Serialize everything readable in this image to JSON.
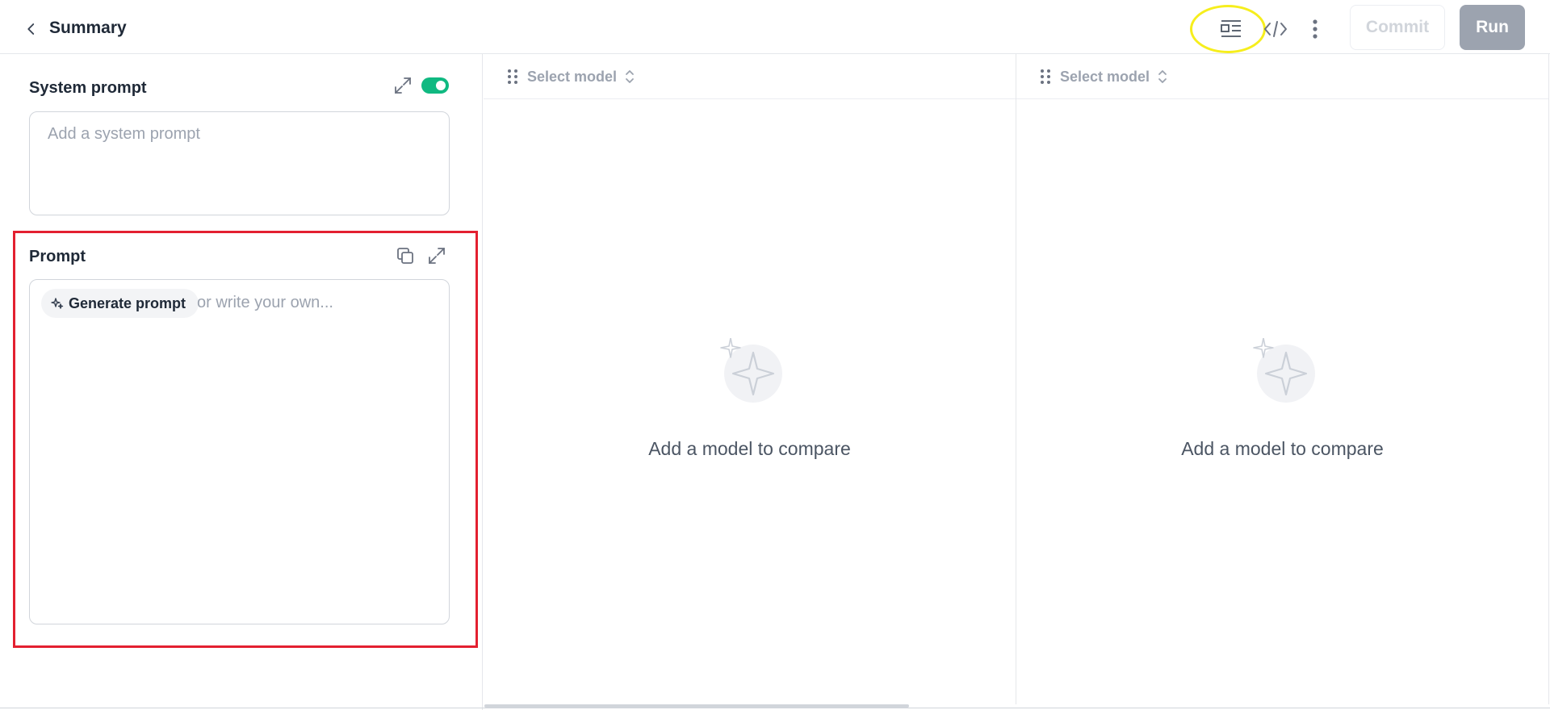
{
  "header": {
    "title": "Summary",
    "icons": [
      "chevron-left-icon",
      "layout-icon",
      "code-icon",
      "more-vertical-icon"
    ],
    "commit_label": "Commit",
    "run_label": "Run"
  },
  "system_prompt": {
    "title": "System prompt",
    "placeholder": "Add a system prompt",
    "enabled": true
  },
  "prompt": {
    "title": "Prompt",
    "generate_label": "Generate prompt",
    "placeholder": "or write your own..."
  },
  "panes": [
    {
      "select_label": "Select model",
      "empty_text": "Add a model to compare"
    },
    {
      "select_label": "Select model",
      "empty_text": "Add a model to compare"
    }
  ],
  "colors": {
    "accent_toggle": "#10b981",
    "run_button": "#9ca3af",
    "highlight_yellow": "#f6ee1d",
    "highlight_red": "#e32030"
  }
}
